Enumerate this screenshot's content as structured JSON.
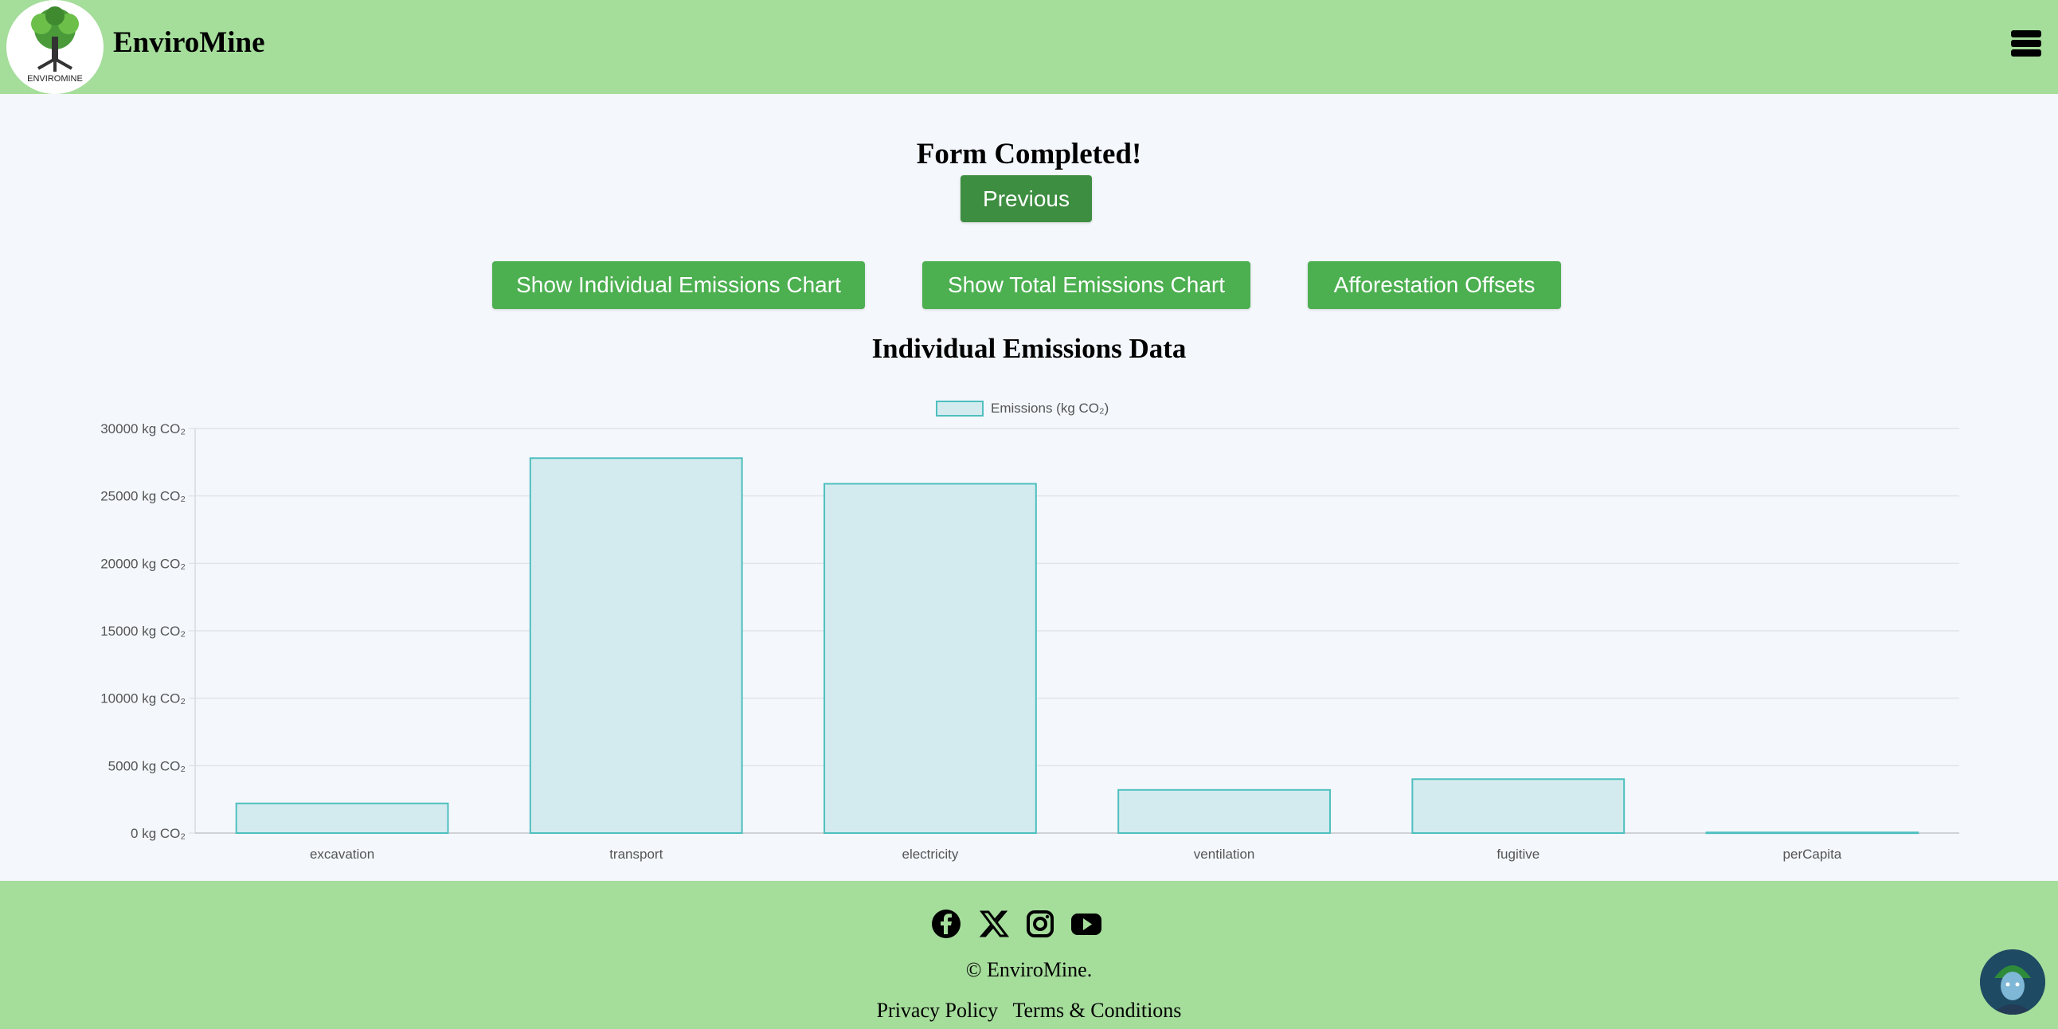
{
  "header": {
    "brand": "EnviroMine",
    "logo_text": "ENVIROMINE"
  },
  "main": {
    "status_title": "Form Completed!",
    "previous_label": "Previous",
    "buttons": {
      "individual": "Show Individual Emissions Chart",
      "total": "Show Total Emissions Chart",
      "afforestation": "Afforestation Offsets"
    },
    "chart_heading": "Individual Emissions Data"
  },
  "chart_data": {
    "type": "bar",
    "categories": [
      "excavation",
      "transport",
      "electricity",
      "ventilation",
      "fugitive",
      "perCapita"
    ],
    "series": [
      {
        "name": "Emissions (kg CO₂)",
        "values": [
          2200,
          27800,
          25900,
          3200,
          4000,
          50
        ]
      }
    ],
    "ylim": [
      0,
      30000
    ],
    "yticks": [
      "0 kg CO₂",
      "5000 kg CO₂",
      "10000 kg CO₂",
      "15000 kg CO₂",
      "20000 kg CO₂",
      "25000 kg CO₂",
      "30000 kg CO₂"
    ],
    "ytick_values": [
      0,
      5000,
      10000,
      15000,
      20000,
      25000,
      30000
    ],
    "grid": true,
    "legend": "top-center",
    "colors": {
      "fill": "#d3ebef",
      "stroke": "#4fbfbf"
    }
  },
  "footer": {
    "social_icons": [
      "facebook-icon",
      "x-icon",
      "instagram-icon",
      "youtube-icon"
    ],
    "copyright": "© EnviroMine.",
    "privacy": "Privacy Policy",
    "terms": "Terms & Conditions"
  },
  "colors": {
    "header_bg": "#a5dd9b",
    "page_bg": "#f4f7fc",
    "button": "#4caf50",
    "button_dark": "#3e8e41"
  }
}
